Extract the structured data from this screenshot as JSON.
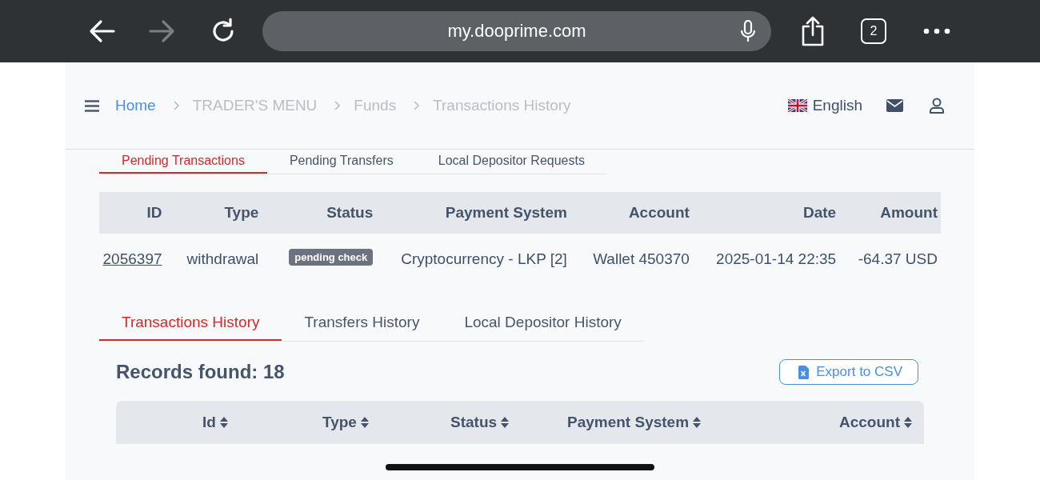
{
  "browser": {
    "url": "my.dooprime.com",
    "tab_count": "2"
  },
  "breadcrumb": [
    {
      "label": "Home",
      "kind": "link"
    },
    {
      "label": "TRADER'S MENU",
      "kind": "muted"
    },
    {
      "label": "Funds",
      "kind": "muted"
    },
    {
      "label": "Transactions History",
      "kind": "muted"
    }
  ],
  "language": "English",
  "pending_tabs": [
    {
      "label": "Pending Transactions",
      "selected": true
    },
    {
      "label": "Pending Transfers",
      "selected": false
    },
    {
      "label": "Local Depositor Requests",
      "selected": false
    }
  ],
  "pending_table": {
    "columns": [
      "ID",
      "Type",
      "Status",
      "Payment System",
      "Account",
      "Date",
      "Amount"
    ],
    "rows": [
      {
        "id": "2056397",
        "type": "withdrawal",
        "status": "pending check",
        "payment_system": "Cryptocurrency - LKP [2]",
        "account": "Wallet 450370",
        "date": "2025-01-14 22:35",
        "amount": "-64.37 USD"
      }
    ]
  },
  "history_tabs": [
    {
      "label": "Transactions History",
      "selected": true
    },
    {
      "label": "Transfers History",
      "selected": false
    },
    {
      "label": "Local Depositor History",
      "selected": false
    }
  ],
  "records_found": "Records found: 18",
  "export_button": "Export to CSV",
  "history_table": {
    "columns": [
      "Id",
      "Type",
      "Status",
      "Payment System",
      "Account"
    ]
  }
}
